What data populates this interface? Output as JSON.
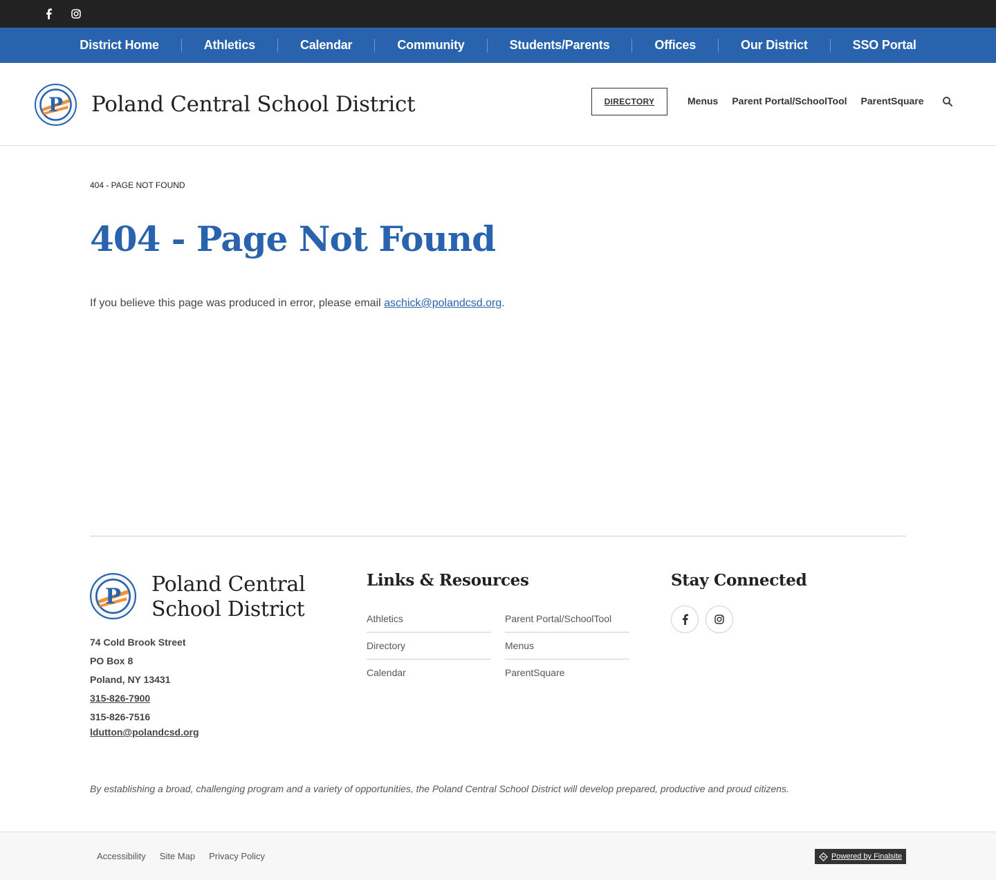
{
  "topbar": {
    "facebook_icon": "facebook-icon",
    "instagram_icon": "instagram-icon"
  },
  "nav": {
    "items": [
      "District Home",
      "Athletics",
      "Calendar",
      "Community",
      "Students/Parents",
      "Offices",
      "Our District",
      "SSO Portal"
    ]
  },
  "header": {
    "title": "Poland Central School District",
    "directory_label": "DIRECTORY",
    "links": [
      "Menus",
      "Parent Portal/SchoolTool",
      "ParentSquare"
    ],
    "search_icon": "search-icon"
  },
  "content": {
    "breadcrumb": "404 - PAGE NOT FOUND",
    "title": "404 - Page Not Found",
    "message": "If you believe this page was produced in error, please email ",
    "email": "aschick@polandcsd.org",
    "message_end": "."
  },
  "footer": {
    "title_line1": "Poland Central",
    "title_line2": "School District",
    "address": {
      "street": "74 Cold Brook Street",
      "po_box": "PO Box 8",
      "city": "Poland, NY  13431",
      "phone": "315-826-7900",
      "fax": "315-826-7516",
      "email": "ldutton@polandcsd.org"
    },
    "links_title": "Links & Resources",
    "links_col1": [
      "Athletics",
      "Directory",
      "Calendar"
    ],
    "links_col2": [
      "Parent Portal/SchoolTool",
      "Menus",
      "ParentSquare"
    ],
    "stay_title": "Stay Connected",
    "mission": "By establishing a broad, challenging program and a variety of opportunities, the Poland Central School District will develop prepared, productive and proud citizens.",
    "bottom_links": [
      "Accessibility",
      "Site Map",
      "Privacy Policy"
    ],
    "powered_by": "Powered by Finalsite"
  },
  "colors": {
    "brand_blue": "#2a63ad",
    "topbar": "#222222",
    "accent_orange": "#f0913a"
  }
}
